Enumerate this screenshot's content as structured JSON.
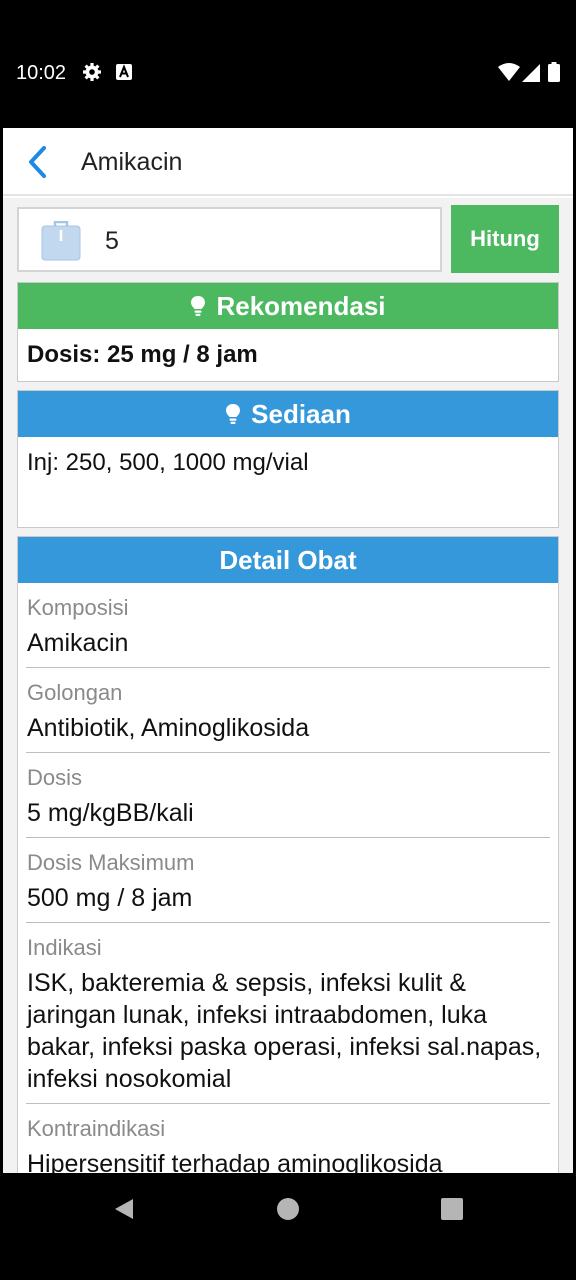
{
  "status_bar": {
    "time": "10:02"
  },
  "app_bar": {
    "title": "Amikacin"
  },
  "weight_input": {
    "value": "5"
  },
  "hitung_button": {
    "label": "Hitung"
  },
  "rekomendasi": {
    "title": "Rekomendasi",
    "text": "Dosis: 25 mg / 8 jam"
  },
  "sediaan": {
    "title": "Sediaan",
    "text": "Inj: 250, 500, 1000 mg/vial"
  },
  "detail": {
    "title": "Detail Obat",
    "rows": [
      {
        "label": "Komposisi",
        "value": "Amikacin"
      },
      {
        "label": "Golongan",
        "value": "Antibiotik, Aminoglikosida"
      },
      {
        "label": "Dosis",
        "value": "5 mg/kgBB/kali"
      },
      {
        "label": "Dosis Maksimum",
        "value": "500 mg / 8 jam"
      },
      {
        "label": "Indikasi",
        "value": "ISK, bakteremia & sepsis, infeksi kulit & jaringan lunak, infeksi intraabdomen, luka bakar, infeksi paska operasi, infeksi sal.napas, infeksi nosokomial"
      },
      {
        "label": "Kontraindikasi",
        "value": "Hipersensitif terhadap aminoglikosida"
      }
    ]
  },
  "colors": {
    "green": "#4cb960",
    "blue": "#3498db",
    "accent": "#1e88e5"
  },
  "icons": {
    "back": "chevron-left-icon",
    "weight": "scale-icon",
    "bulb": "lightbulb-icon"
  }
}
